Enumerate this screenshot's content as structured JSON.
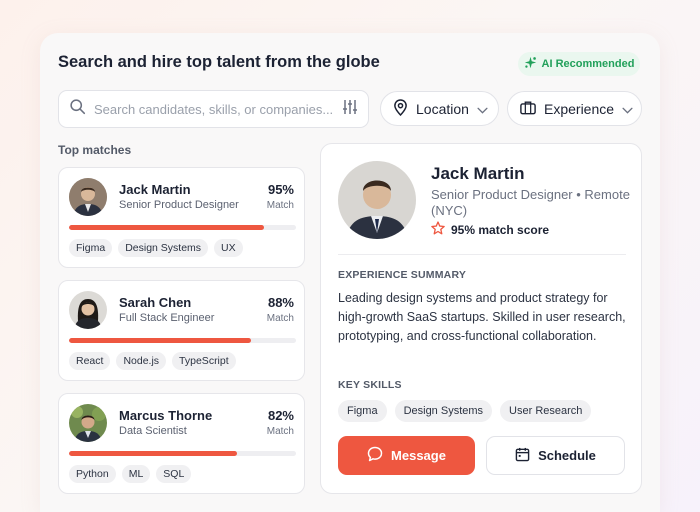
{
  "header": {
    "title": "Search and hire top talent from the globe",
    "ai_badge": "AI Recommended"
  },
  "search": {
    "placeholder": "Search candidates, skills, or companies...",
    "value": ""
  },
  "filters": {
    "location": "Location",
    "experience": "Experience"
  },
  "matches": {
    "label": "Top matches",
    "items": [
      {
        "name": "Jack Martin",
        "role": "Senior Product Designer",
        "pct": "95%",
        "match_label": "Match",
        "progress": 0.86,
        "tags": [
          "Figma",
          "Design Systems",
          "UX"
        ]
      },
      {
        "name": "Sarah Chen",
        "role": "Full Stack Engineer",
        "pct": "88%",
        "match_label": "Match",
        "progress": 0.8,
        "tags": [
          "React",
          "Node.js",
          "TypeScript"
        ]
      },
      {
        "name": "Marcus Thorne",
        "role": "Data Scientist",
        "pct": "82%",
        "match_label": "Match",
        "progress": 0.74,
        "tags": [
          "Python",
          "ML",
          "SQL"
        ]
      }
    ]
  },
  "detail": {
    "name": "Jack Martin",
    "role": "Senior Product Designer • Remote (NYC)",
    "score": "95% match score",
    "summary_label": "EXPERIENCE SUMMARY",
    "summary": "Leading design systems and product strategy for high-growth SaaS startups. Skilled in user research, prototyping, and cross-functional collaboration.",
    "skills_label": "KEY SKILLS",
    "skills": [
      "Figma",
      "Design Systems",
      "User Research"
    ],
    "message_label": "Message",
    "schedule_label": "Schedule"
  },
  "colors": {
    "accent": "#ee5740",
    "ai_green": "#21a05a"
  }
}
